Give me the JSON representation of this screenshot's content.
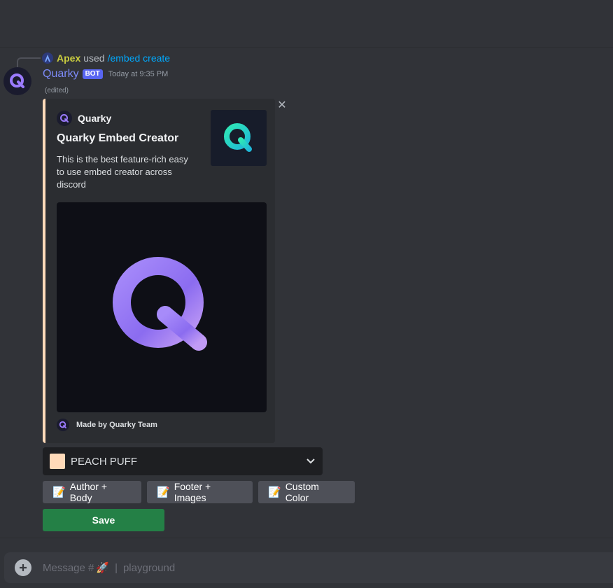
{
  "command": {
    "user": "Apex",
    "used_text": "used",
    "command_name": "/embed create"
  },
  "message": {
    "username": "Quarky",
    "bot_tag": "BOT",
    "timestamp": "Today at 9:35 PM",
    "edited": "(edited)"
  },
  "embed": {
    "color": "#ffdab9",
    "author": "Quarky",
    "title": "Quarky Embed Creator",
    "description": "This is the best feature-rich easy to use embed creator across discord",
    "footer": "Made by Quarky Team"
  },
  "select": {
    "selected_label": "PEACH PUFF",
    "swatch_color": "#ffdab9"
  },
  "buttons": [
    {
      "emoji": "📝",
      "label": "Author + Body"
    },
    {
      "emoji": "📝",
      "label": "Footer + Images"
    },
    {
      "emoji": "📝",
      "label": "Custom Color"
    }
  ],
  "save_label": "Save",
  "input": {
    "placeholder_prefix": "Message #",
    "channel_emoji": "🚀",
    "separator": "|",
    "channel_name": "playground"
  }
}
